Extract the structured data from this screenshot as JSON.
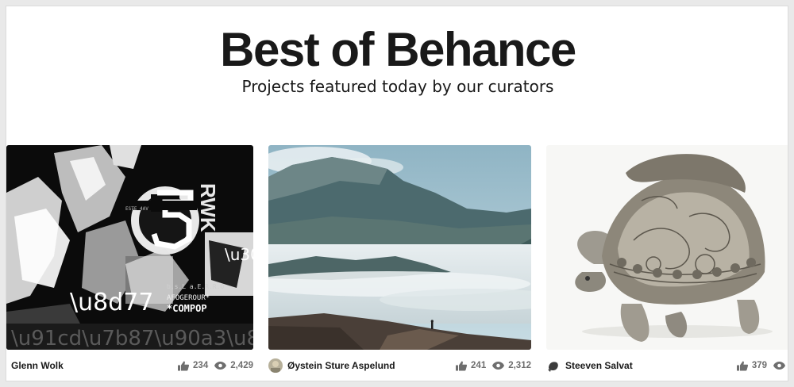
{
  "header": {
    "title": "Best of Behance",
    "subtitle": "Projects featured today by our curators"
  },
  "projects": [
    {
      "owner": "Glenn Wolk",
      "appreciations": "234",
      "views": "2,429",
      "thumbnail": "black-white-typographic-collage"
    },
    {
      "owner": "Øystein Sture Aspelund",
      "appreciations": "241",
      "views": "2,312",
      "thumbnail": "mountain-landscape-fog-hiker"
    },
    {
      "owner": "Steeven Salvat",
      "appreciations": "379",
      "views": "",
      "thumbnail": "ornate-engraved-tortoise"
    }
  ],
  "icons": {
    "appreciate": "thumbs-up-icon",
    "views": "eye-icon"
  },
  "colors": {
    "text": "#191919",
    "muted": "#6e6e6e",
    "background": "#ffffff"
  }
}
